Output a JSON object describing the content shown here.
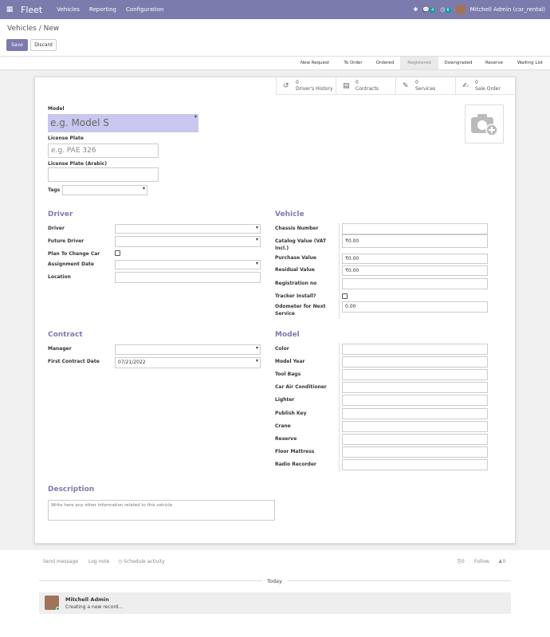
{
  "navbar": {
    "brand": "Fleet",
    "menus": [
      "Vehicles",
      "Reporting",
      "Configuration"
    ],
    "user": "Mitchell Admin (car_rental)",
    "chat_count": "4",
    "activity_count": "6"
  },
  "control_panel": {
    "breadcrumb": "Vehicles / New",
    "save_label": "Save",
    "discard_label": "Discard"
  },
  "statusbar": {
    "stages": [
      "New Request",
      "To Order",
      "Ordered",
      "Registered",
      "Downgraded",
      "Reserve",
      "Waiting List"
    ],
    "active_stage": "Registered"
  },
  "smart_buttons": [
    {
      "count": "0",
      "label": "Driver's History"
    },
    {
      "count": "0",
      "label": "Contracts"
    },
    {
      "count": "0",
      "label": "Services"
    },
    {
      "count": "0",
      "label": "Sale Order"
    }
  ],
  "form": {
    "model_label": "Model",
    "model_placeholder": "e.g. Model S",
    "license_plate_label": "License Plate",
    "license_plate_placeholder": "e.g. PAE 326",
    "license_plate_arabic_label": "License Plate (Arabic)",
    "tags_label": "Tags",
    "driver_section": {
      "title": "Driver",
      "fields": {
        "driver": "Driver",
        "future_driver": "Future Driver",
        "plan_to_change_car": "Plan To Change Car",
        "assignment_date": "Assignment Date",
        "location": "Location"
      }
    },
    "vehicle_section": {
      "title": "Vehicle",
      "fields": {
        "chassis_number": "Chassis Number",
        "catalog_value_label": "Catalog Value (VAT Incl.)",
        "catalog_value": "₹0.00",
        "purchase_value_label": "Purchase Value",
        "purchase_value": "₹0.00",
        "residual_value_label": "Residual Value",
        "residual_value": "₹0.00",
        "registration_no": "Registration no",
        "tracker_install": "Tracker Install?",
        "odometer_label": "Odometer for Next Service",
        "odometer_value": "0.00"
      }
    },
    "contract_section": {
      "title": "Contract",
      "fields": {
        "manager": "Manager",
        "first_contract_date_label": "First Contract Date",
        "first_contract_date": "07/21/2022"
      }
    },
    "model_section": {
      "title": "Model",
      "fields": [
        "Color",
        "Model Year",
        "Tool Bags",
        "Car Air Conditioner",
        "Lighter",
        "Publish Key",
        "Crane",
        "Reserve",
        "Floor Mattress",
        "Radio Recorder"
      ]
    },
    "description": {
      "title": "Description",
      "placeholder": "Write here any other information related to this vehicle"
    }
  },
  "chatter": {
    "send_message": "Send message",
    "log_note": "Log note",
    "schedule_activity": "Schedule activity",
    "attachments": "0",
    "follow": "Follow",
    "followers": "0",
    "separator": "Today",
    "message_author": "Mitchell Admin",
    "message_body": "Creating a new record..."
  }
}
